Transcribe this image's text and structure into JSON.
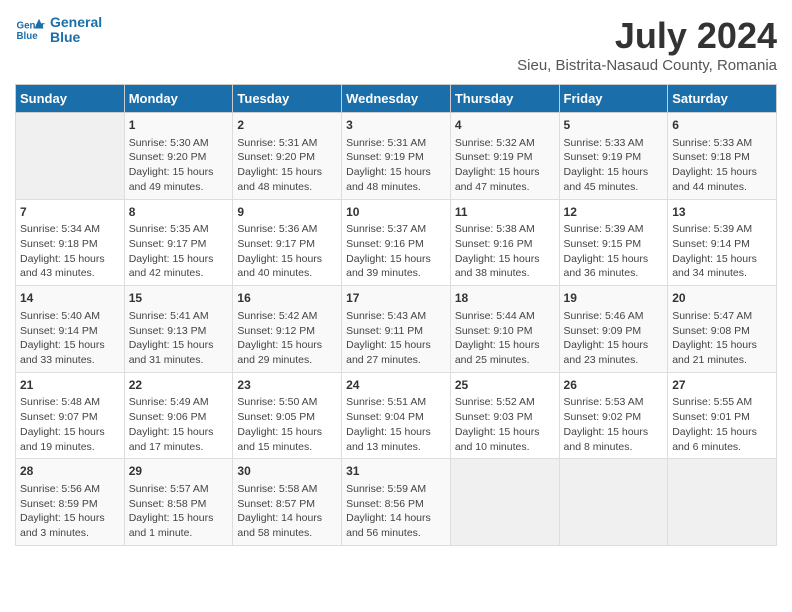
{
  "app": {
    "name": "GeneralBlue",
    "logo_line1": "General",
    "logo_line2": "Blue"
  },
  "calendar": {
    "title": "July 2024",
    "subtitle": "Sieu, Bistrita-Nasaud County, Romania",
    "days_of_week": [
      "Sunday",
      "Monday",
      "Tuesday",
      "Wednesday",
      "Thursday",
      "Friday",
      "Saturday"
    ],
    "weeks": [
      [
        {
          "day": "",
          "content": ""
        },
        {
          "day": "1",
          "content": "Sunrise: 5:30 AM\nSunset: 9:20 PM\nDaylight: 15 hours\nand 49 minutes."
        },
        {
          "day": "2",
          "content": "Sunrise: 5:31 AM\nSunset: 9:20 PM\nDaylight: 15 hours\nand 48 minutes."
        },
        {
          "day": "3",
          "content": "Sunrise: 5:31 AM\nSunset: 9:19 PM\nDaylight: 15 hours\nand 48 minutes."
        },
        {
          "day": "4",
          "content": "Sunrise: 5:32 AM\nSunset: 9:19 PM\nDaylight: 15 hours\nand 47 minutes."
        },
        {
          "day": "5",
          "content": "Sunrise: 5:33 AM\nSunset: 9:19 PM\nDaylight: 15 hours\nand 45 minutes."
        },
        {
          "day": "6",
          "content": "Sunrise: 5:33 AM\nSunset: 9:18 PM\nDaylight: 15 hours\nand 44 minutes."
        }
      ],
      [
        {
          "day": "7",
          "content": "Sunrise: 5:34 AM\nSunset: 9:18 PM\nDaylight: 15 hours\nand 43 minutes."
        },
        {
          "day": "8",
          "content": "Sunrise: 5:35 AM\nSunset: 9:17 PM\nDaylight: 15 hours\nand 42 minutes."
        },
        {
          "day": "9",
          "content": "Sunrise: 5:36 AM\nSunset: 9:17 PM\nDaylight: 15 hours\nand 40 minutes."
        },
        {
          "day": "10",
          "content": "Sunrise: 5:37 AM\nSunset: 9:16 PM\nDaylight: 15 hours\nand 39 minutes."
        },
        {
          "day": "11",
          "content": "Sunrise: 5:38 AM\nSunset: 9:16 PM\nDaylight: 15 hours\nand 38 minutes."
        },
        {
          "day": "12",
          "content": "Sunrise: 5:39 AM\nSunset: 9:15 PM\nDaylight: 15 hours\nand 36 minutes."
        },
        {
          "day": "13",
          "content": "Sunrise: 5:39 AM\nSunset: 9:14 PM\nDaylight: 15 hours\nand 34 minutes."
        }
      ],
      [
        {
          "day": "14",
          "content": "Sunrise: 5:40 AM\nSunset: 9:14 PM\nDaylight: 15 hours\nand 33 minutes."
        },
        {
          "day": "15",
          "content": "Sunrise: 5:41 AM\nSunset: 9:13 PM\nDaylight: 15 hours\nand 31 minutes."
        },
        {
          "day": "16",
          "content": "Sunrise: 5:42 AM\nSunset: 9:12 PM\nDaylight: 15 hours\nand 29 minutes."
        },
        {
          "day": "17",
          "content": "Sunrise: 5:43 AM\nSunset: 9:11 PM\nDaylight: 15 hours\nand 27 minutes."
        },
        {
          "day": "18",
          "content": "Sunrise: 5:44 AM\nSunset: 9:10 PM\nDaylight: 15 hours\nand 25 minutes."
        },
        {
          "day": "19",
          "content": "Sunrise: 5:46 AM\nSunset: 9:09 PM\nDaylight: 15 hours\nand 23 minutes."
        },
        {
          "day": "20",
          "content": "Sunrise: 5:47 AM\nSunset: 9:08 PM\nDaylight: 15 hours\nand 21 minutes."
        }
      ],
      [
        {
          "day": "21",
          "content": "Sunrise: 5:48 AM\nSunset: 9:07 PM\nDaylight: 15 hours\nand 19 minutes."
        },
        {
          "day": "22",
          "content": "Sunrise: 5:49 AM\nSunset: 9:06 PM\nDaylight: 15 hours\nand 17 minutes."
        },
        {
          "day": "23",
          "content": "Sunrise: 5:50 AM\nSunset: 9:05 PM\nDaylight: 15 hours\nand 15 minutes."
        },
        {
          "day": "24",
          "content": "Sunrise: 5:51 AM\nSunset: 9:04 PM\nDaylight: 15 hours\nand 13 minutes."
        },
        {
          "day": "25",
          "content": "Sunrise: 5:52 AM\nSunset: 9:03 PM\nDaylight: 15 hours\nand 10 minutes."
        },
        {
          "day": "26",
          "content": "Sunrise: 5:53 AM\nSunset: 9:02 PM\nDaylight: 15 hours\nand 8 minutes."
        },
        {
          "day": "27",
          "content": "Sunrise: 5:55 AM\nSunset: 9:01 PM\nDaylight: 15 hours\nand 6 minutes."
        }
      ],
      [
        {
          "day": "28",
          "content": "Sunrise: 5:56 AM\nSunset: 8:59 PM\nDaylight: 15 hours\nand 3 minutes."
        },
        {
          "day": "29",
          "content": "Sunrise: 5:57 AM\nSunset: 8:58 PM\nDaylight: 15 hours\nand 1 minute."
        },
        {
          "day": "30",
          "content": "Sunrise: 5:58 AM\nSunset: 8:57 PM\nDaylight: 14 hours\nand 58 minutes."
        },
        {
          "day": "31",
          "content": "Sunrise: 5:59 AM\nSunset: 8:56 PM\nDaylight: 14 hours\nand 56 minutes."
        },
        {
          "day": "",
          "content": ""
        },
        {
          "day": "",
          "content": ""
        },
        {
          "day": "",
          "content": ""
        }
      ]
    ]
  }
}
